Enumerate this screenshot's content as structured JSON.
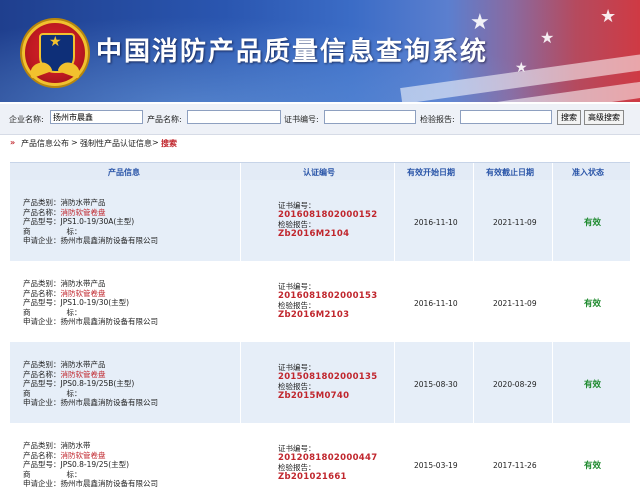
{
  "header": {
    "title": "中国消防产品质量信息查询系统"
  },
  "search": {
    "company_label": "企业名称:",
    "company_value": "扬州市晨鑫",
    "product_label": "产品名称:",
    "product_value": "",
    "cert_label": "证书编号:",
    "cert_value": "",
    "report_label": "检验报告:",
    "report_value": "",
    "search_button": "搜索",
    "advanced_button": "高级搜索"
  },
  "breadcrumb": {
    "item1": "产品信息公布",
    "sep": ">",
    "item2": "强制性产品认证信息",
    "item3": "搜索"
  },
  "table": {
    "headers": [
      "产品信息",
      "认证编号",
      "有效开始日期",
      "有效截止日期",
      "准入状态"
    ],
    "rows": [
      {
        "category": "产品类别：消防水带产品",
        "name_label": "产品名称：",
        "name": "消防软管卷盘",
        "model": "产品型号：JPS1.0-19/30A(主型)",
        "brand1": "商",
        "brand2": "标：",
        "company": "申请企业：扬州市晨鑫消防设备有限公司",
        "cert_label": "证书编号：",
        "cert_no": "2016081802000152",
        "report_label": "检验报告：",
        "report_no": "Zb2016M2104",
        "start": "2016-11-10",
        "end": "2021-11-09",
        "status": "有效"
      },
      {
        "category": "产品类别：消防水带产品",
        "name_label": "产品名称：",
        "name": "消防软管卷盘",
        "model": "产品型号：JPS1.0-19/30(主型)",
        "brand1": "商",
        "brand2": "标：",
        "company": "申请企业：扬州市晨鑫消防设备有限公司",
        "cert_label": "证书编号：",
        "cert_no": "2016081802000153",
        "report_label": "检验报告：",
        "report_no": "Zb2016M2103",
        "start": "2016-11-10",
        "end": "2021-11-09",
        "status": "有效"
      },
      {
        "category": "产品类别：消防水带产品",
        "name_label": "产品名称：",
        "name": "消防软管卷盘",
        "model": "产品型号：JPS0.8-19/25B(主型)",
        "brand1": "商",
        "brand2": "标：",
        "company": "申请企业：扬州市晨鑫消防设备有限公司",
        "cert_label": "证书编号：",
        "cert_no": "2015081802000135",
        "report_label": "检验报告：",
        "report_no": "Zb2015M0740",
        "start": "2015-08-30",
        "end": "2020-08-29",
        "status": "有效"
      },
      {
        "category": "产品类别：消防水带",
        "name_label": "产品名称：",
        "name": "消防软管卷盘",
        "model": "产品型号：JPS0.8-19/25(主型)",
        "brand1": "商",
        "brand2": "标：",
        "company": "申请企业：扬州市晨鑫消防设备有限公司",
        "cert_label": "证书编号：",
        "cert_no": "2012081802000447",
        "report_label": "检验报告：",
        "report_no": "Zb201021661",
        "start": "2015-03-19",
        "end": "2017-11-26",
        "status": "有效"
      }
    ]
  },
  "colors": {
    "banner_blue": "#2a56b0",
    "accent_red": "#c0262d",
    "status_green": "#1e8a2e",
    "header_text": "#2a55a8"
  }
}
